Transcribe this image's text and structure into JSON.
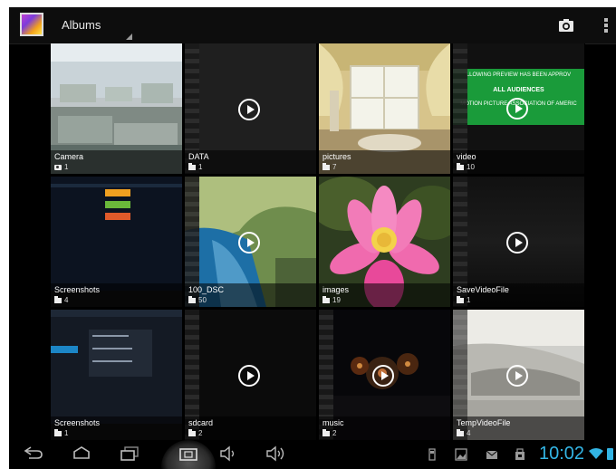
{
  "action_bar": {
    "title": "Albums",
    "camera_icon": "camera-icon",
    "overflow_icon": "overflow-menu-icon"
  },
  "albums": [
    {
      "name": "Camera",
      "count": "1",
      "type": "camera"
    },
    {
      "name": "DATA",
      "count": "1",
      "type": "video"
    },
    {
      "name": "pictures",
      "count": "7",
      "type": "folder"
    },
    {
      "name": "video",
      "count": "10",
      "type": "video"
    },
    {
      "name": "Screenshots",
      "count": "4",
      "type": "folder"
    },
    {
      "name": "100_DSC",
      "count": "50",
      "type": "video"
    },
    {
      "name": "images",
      "count": "19",
      "type": "folder"
    },
    {
      "name": "SaveVideoFile",
      "count": "1",
      "type": "video"
    },
    {
      "name": "Screenshots",
      "count": "1",
      "type": "folder"
    },
    {
      "name": "sdcard",
      "count": "2",
      "type": "video"
    },
    {
      "name": "music",
      "count": "2",
      "type": "video"
    },
    {
      "name": "TempVideoFile",
      "count": "4",
      "type": "video"
    }
  ],
  "thumb_texts": {
    "preview_line1": "LLOWING PREVIEW HAS BEEN APPROV",
    "preview_line2": "ALL AUDIENCES",
    "preview_line3": "MOTION PICTURE ASSOCIATION OF AMERIC"
  },
  "status_bar": {
    "time": "10:02",
    "accent_color": "#33b5e5"
  }
}
